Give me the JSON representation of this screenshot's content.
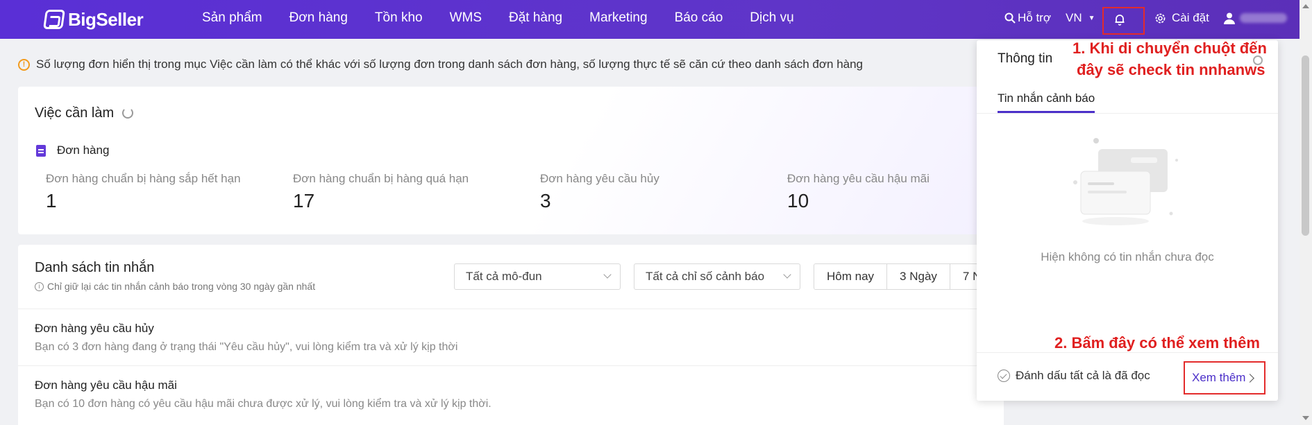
{
  "app": {
    "logo_text": "BigSeller"
  },
  "nav": [
    "Sản phẩm",
    "Đơn hàng",
    "Tồn kho",
    "WMS",
    "Đặt hàng",
    "Marketing",
    "Báo cáo",
    "Dịch vụ"
  ],
  "topright": {
    "support": "Hỗ trợ",
    "lang": "VN",
    "settings": "Cài đặt"
  },
  "notice": "Số lượng đơn hiển thị trong mục Việc cần làm có thể khác với số lượng đơn trong danh sách đơn hàng, số lượng thực tế sẽ căn cứ theo danh sách đơn hàng",
  "todo": {
    "title": "Việc cần làm",
    "section": "Đơn hàng",
    "stats": [
      {
        "label": "Đơn hàng chuẩn bị hàng sắp hết hạn",
        "value": "1"
      },
      {
        "label": "Đơn hàng chuẩn bị hàng quá hạn",
        "value": "17"
      },
      {
        "label": "Đơn hàng yêu cầu hủy",
        "value": "3"
      },
      {
        "label": "Đơn hàng yêu cầu hậu mãi",
        "value": "10"
      }
    ]
  },
  "messages": {
    "title": "Danh sách tin nhắn",
    "note": "Chỉ giữ lại các tin nhắn cảnh báo trong vòng 30 ngày gần nhất",
    "filter_module": "Tất cả mô-đun",
    "filter_index": "Tất cả chỉ số cảnh báo",
    "ranges": [
      "Hôm nay",
      "3 Ngày",
      "7 N"
    ],
    "rows": [
      {
        "title": "Đơn hàng yêu cầu hủy",
        "desc": "Bạn có 3 đơn hàng đang ở trạng thái \"Yêu cầu hủy\", vui lòng kiểm tra và xử lý kịp thời"
      },
      {
        "title": "Đơn hàng yêu cầu hậu mãi",
        "desc": "Bạn có 10 đơn hàng có yêu cầu hậu mãi chưa được xử lý, vui lòng kiểm tra và xử lý kịp thời."
      }
    ]
  },
  "panel": {
    "title": "Thông tin",
    "tab": "Tin nhắn cảnh báo",
    "empty": "Hiện không có tin nhắn chưa đọc",
    "mark_all": "Đánh dấu tất cả là đã đọc",
    "more": "Xem thêm"
  },
  "annotations": {
    "a1_line1": "1. Khi di chuyển chuột đến",
    "a1_line2": "đây sẽ check tin nnhanws",
    "a2": "2. Bấm đây có thể xem thêm",
    "color": "#e02020"
  },
  "colors": {
    "brand": "#5a2fd6",
    "accent": "#4b2fc9",
    "warn": "#f29b1d"
  }
}
